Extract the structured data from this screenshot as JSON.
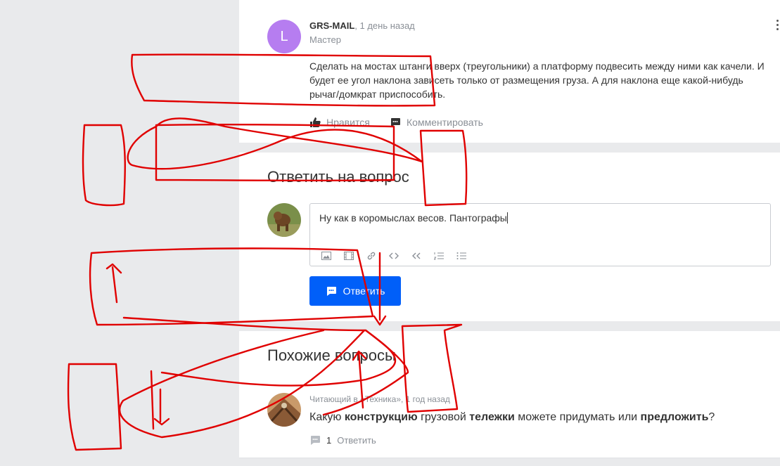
{
  "answer": {
    "avatar_letter": "L",
    "author": "GRS-MAIL",
    "time": ", 1 день назад",
    "role": "Мастер",
    "text": "Сделать на мостах штанги вверх (треугольники) а платформу подвесить между ними как качели. И будет ее угол наклона зависеть только от размещения груза. А для наклона еще какой-нибудь рычаг/домкрат приспособить.",
    "like_label": "Нравится",
    "comment_label": "Комментировать"
  },
  "reply": {
    "title": "Ответить на вопрос",
    "draft": "Ну как в коромыслах весов. Пантографы",
    "toolbar_icons": [
      "image-icon",
      "video-icon",
      "link-icon",
      "code-icon",
      "quote-icon",
      "ordered-list-icon",
      "bullet-list-icon"
    ],
    "button_label": "Ответить"
  },
  "similar": {
    "title": "Похожие вопросы",
    "question": {
      "meta": "Читающий в «Техника», 1 год назад",
      "text_parts": [
        "Какую ",
        "конструкцию",
        " грузовой ",
        "тележки",
        " можете придумать или ",
        "предложить",
        "?"
      ],
      "answers_count": "1",
      "reply_label": "Ответить"
    }
  },
  "colors": {
    "accent": "#005ff9",
    "avatar_bg": "#b67df0",
    "annotation": "#e00000"
  }
}
